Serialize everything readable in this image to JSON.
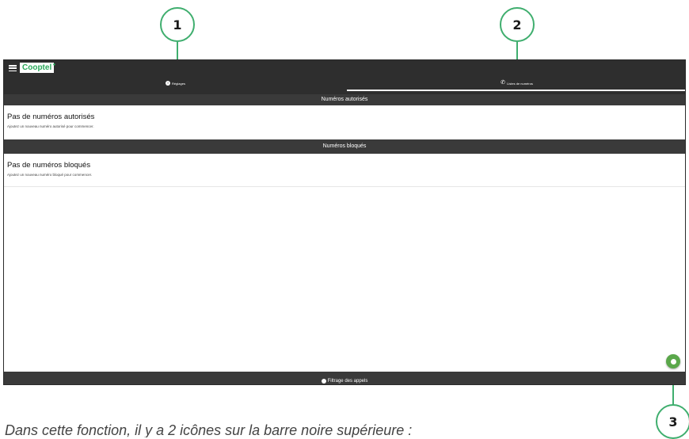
{
  "callouts": {
    "one": "1",
    "two": "2",
    "three": "3"
  },
  "app": {
    "logo_text": "Cooptel",
    "tabs": [
      {
        "label": "Réglages",
        "icon": "info-icon"
      },
      {
        "label": "Listes de numéros",
        "icon": "phone-icon"
      }
    ],
    "sections": {
      "authorized": {
        "header": "Numéros autorisés",
        "empty_title": "Pas de numéros autorisés",
        "empty_subtitle": "Ajoutez un nouveau numéro autorisé pour commencer."
      },
      "blocked": {
        "header": "Numéros bloqués",
        "empty_title": "Pas de numéros bloqués",
        "empty_subtitle": "Ajoutez un nouveau numéro bloqué pour commencer."
      }
    },
    "bottom_bar": {
      "label": "Filtrage des appels",
      "icon": "info-icon"
    },
    "fab": {
      "icon": "info-icon"
    }
  },
  "caption": "Dans cette fonction, il y a 2 icônes sur la barre noire supérieure :",
  "colors": {
    "accent": "#3fae6e",
    "bar": "#2e2e2e",
    "fab": "#5aa74a"
  }
}
